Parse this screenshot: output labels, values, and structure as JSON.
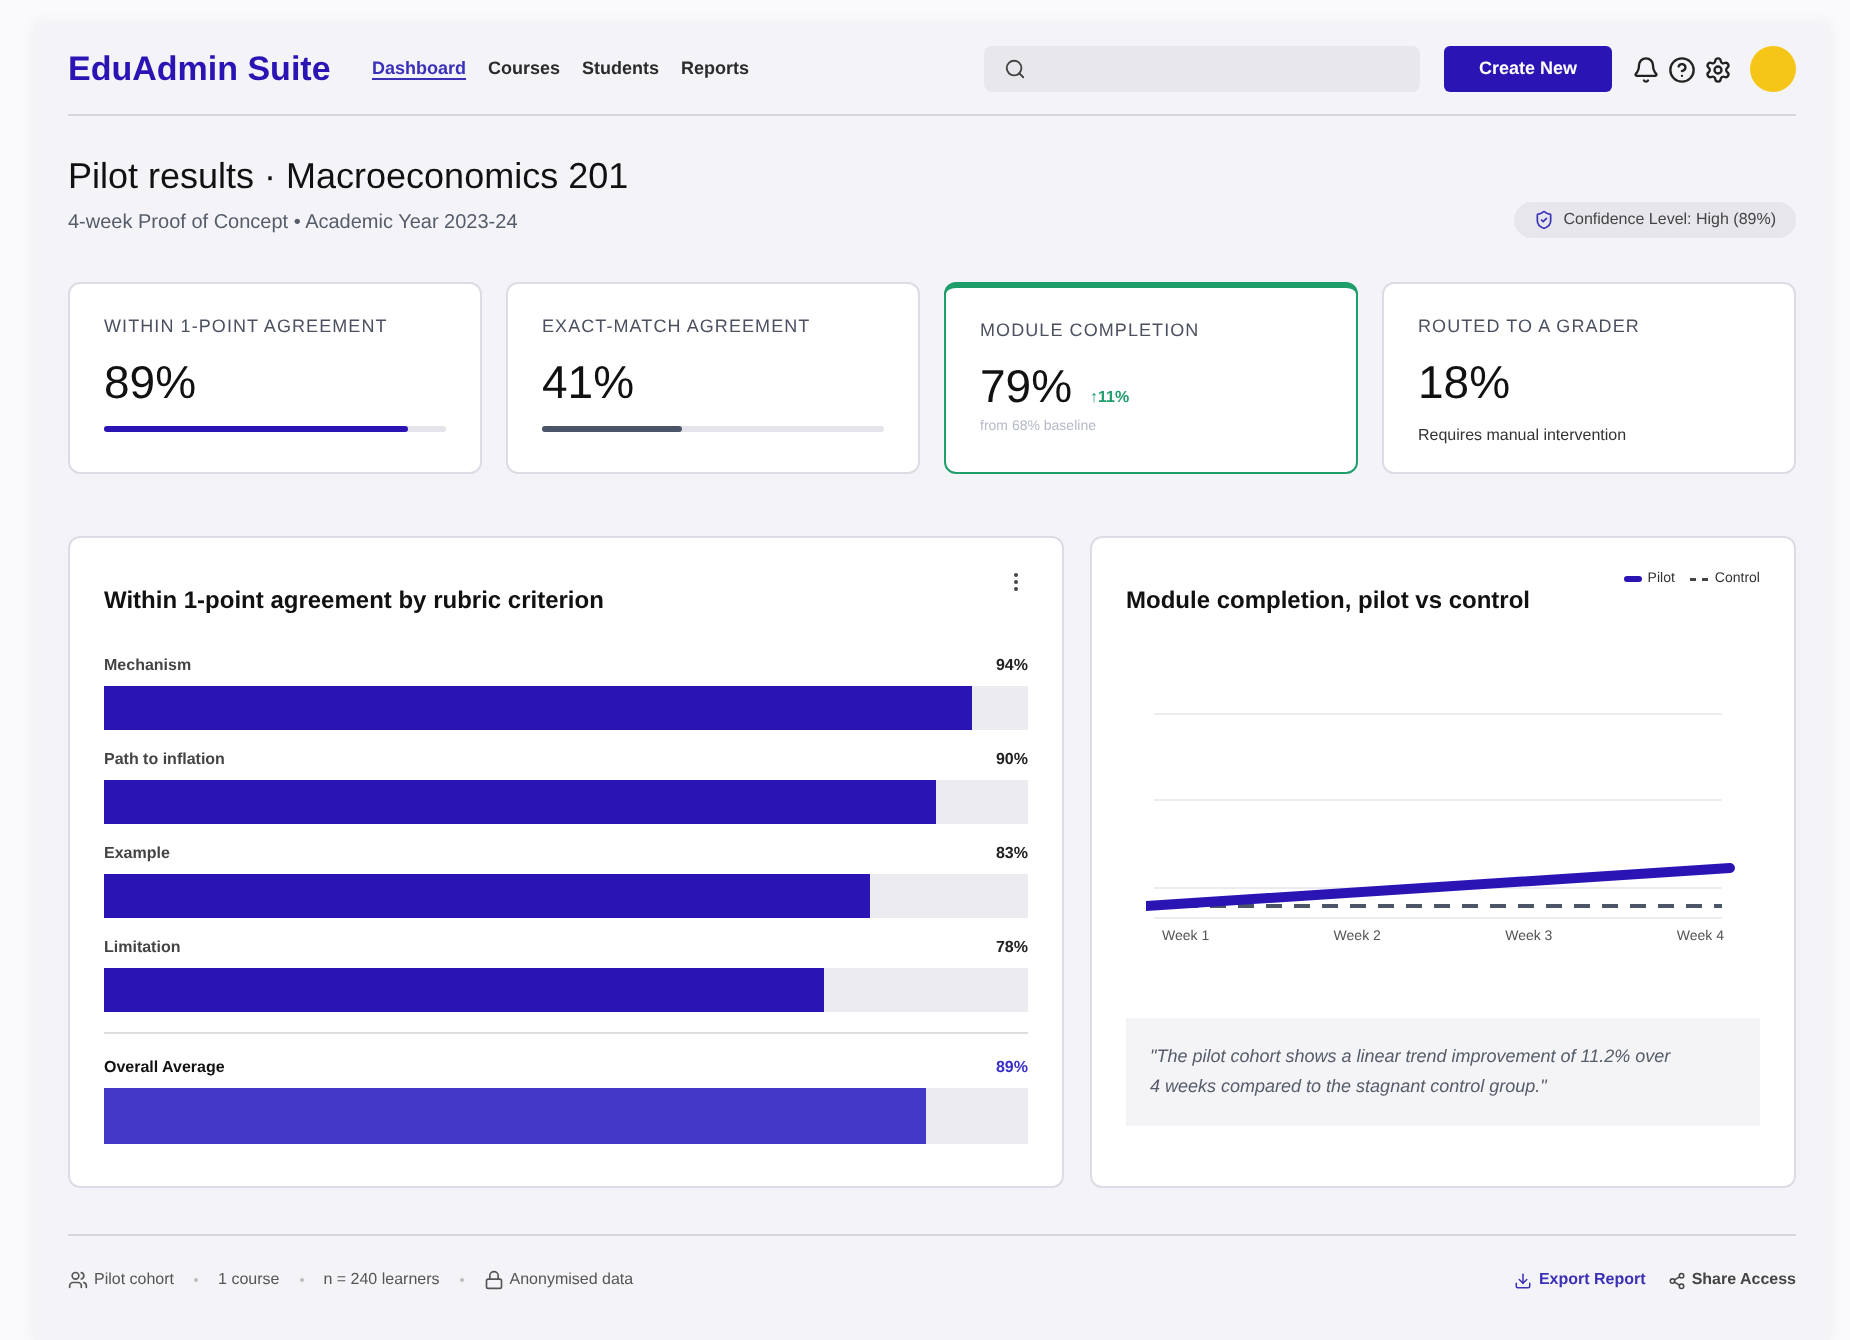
{
  "header": {
    "logo": "EduAdmin Suite",
    "nav": [
      {
        "label": "Dashboard",
        "selected": true
      },
      {
        "label": "Courses",
        "selected": false
      },
      {
        "label": "Students",
        "selected": false
      },
      {
        "label": "Reports",
        "selected": false
      }
    ],
    "create_button": "Create New"
  },
  "page": {
    "title": "Pilot results · Macroeconomics 201",
    "subtitle": "4-week Proof of Concept • Academic Year 2023-24",
    "confidence_badge": "Confidence Level: High (89%)"
  },
  "cards": [
    {
      "kind": "bar",
      "label": "WITHIN 1-POINT AGREEMENT",
      "value": "89%",
      "level": 0.89,
      "color": "#2a14b4",
      "highlighted": false
    },
    {
      "kind": "bar",
      "label": "EXACT-MATCH AGREEMENT",
      "value": "41%",
      "level": 0.41,
      "color": "#4b5567",
      "highlighted": false
    },
    {
      "kind": "delta",
      "label": "MODULE COMPLETION",
      "value": "79%",
      "delta": "↑11%",
      "note": "from 68% baseline",
      "highlighted": true
    },
    {
      "kind": "note",
      "label": "ROUTED TO A GRADER",
      "value": "18%",
      "note": "Requires manual intervention",
      "highlighted": false
    }
  ],
  "agreement_panel": {
    "title": "Within 1-point agreement by rubric criterion",
    "rows": [
      {
        "kind": "criterion",
        "label": "Mechanism",
        "reading": "94%",
        "level": 0.94
      },
      {
        "kind": "criterion",
        "label": "Path to inflation",
        "reading": "90%",
        "level": 0.9
      },
      {
        "kind": "criterion",
        "label": "Example",
        "reading": "83%",
        "level": 0.83
      },
      {
        "kind": "criterion",
        "label": "Limitation",
        "reading": "78%",
        "level": 0.78
      },
      {
        "kind": "average",
        "label": "Overall Average",
        "reading": "89%",
        "level": 0.89
      }
    ]
  },
  "completion_panel": {
    "title": "Module completion, pilot vs control",
    "legend": [
      "Pilot",
      "Control"
    ],
    "x_labels": [
      "Week 1",
      "Week 2",
      "Week 3",
      "Week 4"
    ],
    "quote": "\"The pilot cohort shows a linear trend improvement of 11.2% over 4 weeks compared to the stagnant control group.\""
  },
  "footer": {
    "meta": [
      "Pilot cohort",
      "1 course",
      "n = 240 learners",
      "Anonymised data"
    ],
    "actions": [
      "Export Report",
      "Share Access"
    ]
  }
}
